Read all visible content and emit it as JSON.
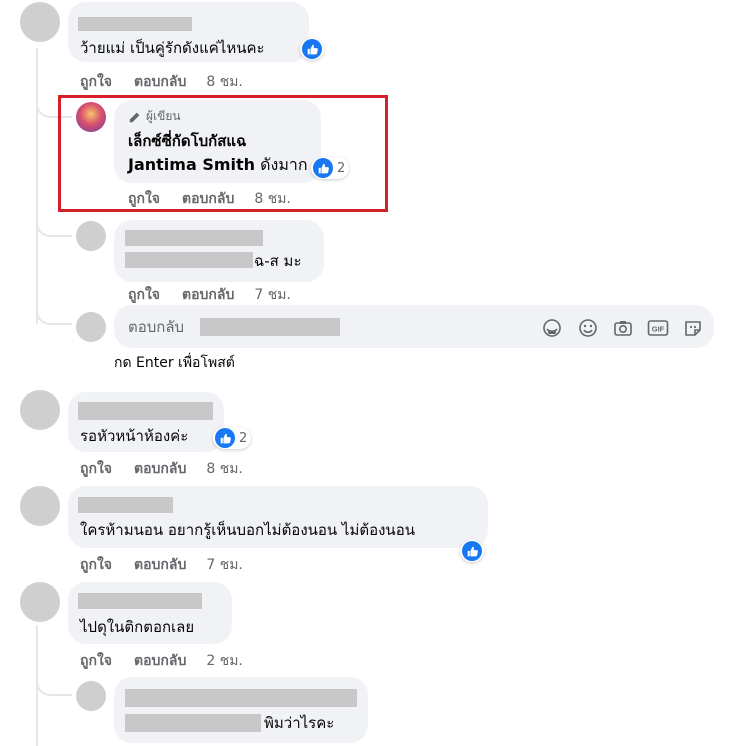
{
  "comments": [
    {
      "text": "ว้ายแม่ เป็นคู่รักดังแค่ไหนคะ",
      "like": "ถูกใจ",
      "reply": "ตอบกลับ",
      "time": "8 ชม."
    },
    {
      "badge": "ผู้เขียน",
      "line1": "เล็กซ์ซี่กัดโบกัสแฉ",
      "mention": "Jantima Smith",
      "line2_rest": " ดังมาก",
      "reactions": "2",
      "like": "ถูกใจ",
      "reply": "ตอบกลับ",
      "time": "8 ชม."
    },
    {
      "text_rest": "ฉ-ส มะ",
      "like": "ถูกใจ",
      "reply": "ตอบกลับ",
      "time": "7 ชม."
    },
    {
      "text": "รอหัวหน้าห้องค่ะ",
      "reactions": "2",
      "like": "ถูกใจ",
      "reply": "ตอบกลับ",
      "time": "8 ชม."
    },
    {
      "text": "ใครห้ามนอน อยากรู้เห็นบอกไม่ต้องนอน ไม่ต้องนอน",
      "like": "ถูกใจ",
      "reply": "ตอบกลับ",
      "time": "7 ชม."
    },
    {
      "text": "ไปดุในติกตอกเลย",
      "like": "ถูกใจ",
      "reply": "ตอบกลับ",
      "time": "2 ชม."
    },
    {
      "text_rest": "พิมว่าไรคะ"
    }
  ],
  "reply_box": {
    "prefix": "ตอบกลับ",
    "hint": "กด Enter เพื่อโพสต์"
  },
  "colors": {
    "like_blue": "#1877f2",
    "bubble": "#f0f2f5",
    "highlight_red": "#d32029"
  },
  "icons": [
    "sticker-icon",
    "emoji-icon",
    "camera-icon",
    "gif-icon",
    "avatar-sticker-icon"
  ]
}
